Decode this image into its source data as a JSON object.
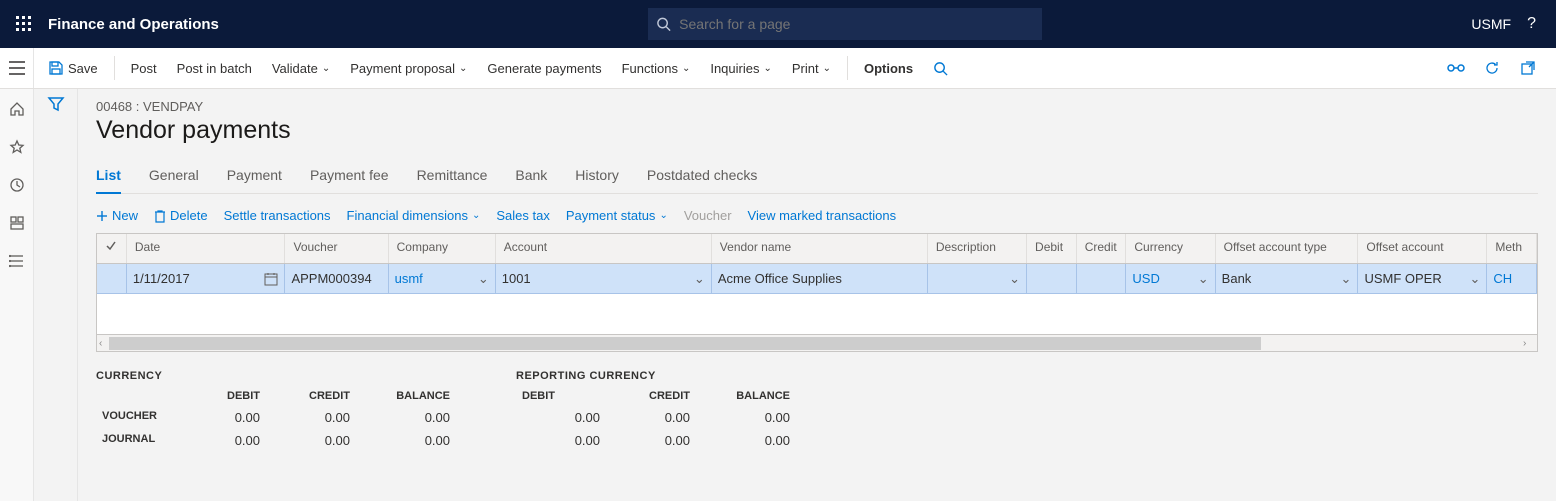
{
  "header": {
    "appTitle": "Finance and Operations",
    "searchPlaceholder": "Search for a page",
    "company": "USMF"
  },
  "commandBar": {
    "save": "Save",
    "post": "Post",
    "postBatch": "Post in batch",
    "validate": "Validate",
    "paymentProposal": "Payment proposal",
    "generatePayments": "Generate payments",
    "functions": "Functions",
    "inquiries": "Inquiries",
    "print": "Print",
    "options": "Options"
  },
  "page": {
    "breadcrumb": "00468 : VENDPAY",
    "title": "Vendor payments"
  },
  "tabs": [
    "List",
    "General",
    "Payment",
    "Payment fee",
    "Remittance",
    "Bank",
    "History",
    "Postdated checks"
  ],
  "activeTab": 0,
  "subToolbar": {
    "new": "New",
    "delete": "Delete",
    "settle": "Settle transactions",
    "finDim": "Financial dimensions",
    "salesTax": "Sales tax",
    "payStatus": "Payment status",
    "voucher": "Voucher",
    "viewMarked": "View marked transactions"
  },
  "grid": {
    "columns": [
      "Date",
      "Voucher",
      "Company",
      "Account",
      "Vendor name",
      "Description",
      "Debit",
      "Credit",
      "Currency",
      "Offset account type",
      "Offset account",
      "Meth"
    ],
    "row": {
      "date": "1/11/2017",
      "voucher": "APPM000394",
      "company": "usmf",
      "account": "1001",
      "vendorName": "Acme Office Supplies",
      "description": "",
      "debit": "",
      "credit": "",
      "currency": "USD",
      "offsetType": "Bank",
      "offsetAccount": "USMF OPER",
      "method": "CH"
    }
  },
  "totals": {
    "currencyLabel": "CURRENCY",
    "reportingLabel": "REPORTING CURRENCY",
    "cols": [
      "DEBIT",
      "CREDIT",
      "BALANCE"
    ],
    "voucherRow": "VOUCHER",
    "journalRow": "JOURNAL",
    "voucher": [
      "0.00",
      "0.00",
      "0.00"
    ],
    "journal": [
      "0.00",
      "0.00",
      "0.00"
    ],
    "repVoucher": [
      "0.00",
      "0.00",
      "0.00"
    ],
    "repJournal": [
      "0.00",
      "0.00",
      "0.00"
    ]
  }
}
